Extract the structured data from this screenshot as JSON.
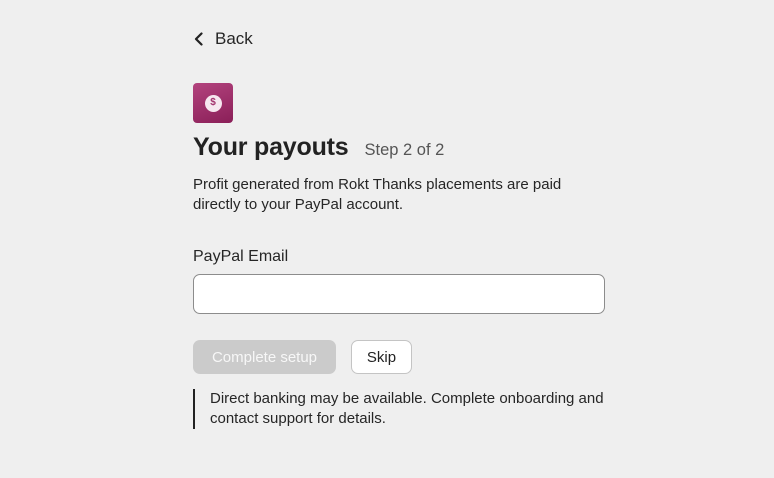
{
  "nav": {
    "back_label": "Back"
  },
  "header": {
    "title": "Your payouts",
    "step": "Step 2 of 2",
    "badge_symbol": "$",
    "badge_icon": "dollar-coin-icon"
  },
  "description": "Profit generated from Rokt Thanks placements are paid directly to your PayPal account.",
  "form": {
    "paypal_email_label": "PayPal Email",
    "paypal_email_value": "",
    "paypal_email_placeholder": ""
  },
  "actions": {
    "complete_label": "Complete setup",
    "skip_label": "Skip"
  },
  "note": "Direct banking may be available. Complete onboarding and contact support for details.",
  "colors": {
    "background": "#efefef",
    "badge_gradient_start": "#b3437e",
    "badge_gradient_end": "#8a1f58",
    "disabled_button": "#cbcbcb"
  }
}
